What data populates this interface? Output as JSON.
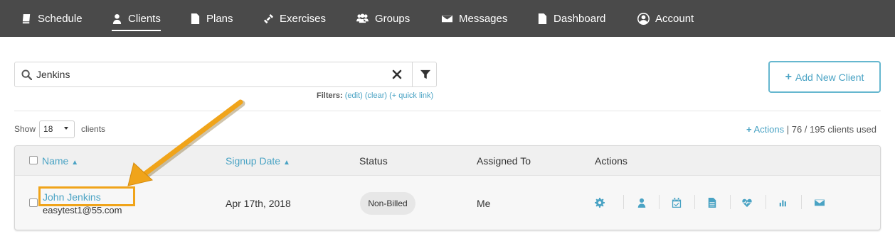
{
  "nav": {
    "items": [
      {
        "label": "Schedule",
        "icon": "book-icon"
      },
      {
        "label": "Clients",
        "icon": "user-icon",
        "active": true
      },
      {
        "label": "Plans",
        "icon": "document-icon"
      },
      {
        "label": "Exercises",
        "icon": "dumbbell-icon"
      },
      {
        "label": "Groups",
        "icon": "group-icon"
      },
      {
        "label": "Messages",
        "icon": "envelope-icon"
      },
      {
        "label": "Dashboard",
        "icon": "document-icon"
      },
      {
        "label": "Account",
        "icon": "account-icon"
      }
    ]
  },
  "search": {
    "value": "Jenkins"
  },
  "filters": {
    "label": "Filters:",
    "edit": "(edit)",
    "clear": "(clear)",
    "quick_link": "(+ quick link)"
  },
  "add_client_label": "Add New Client",
  "show": {
    "prefix": "Show",
    "value": "18",
    "suffix": "clients"
  },
  "usage": {
    "actions_label": "Actions",
    "count_text": "| 76 / 195 clients used"
  },
  "table": {
    "headers": {
      "name": "Name",
      "signup": "Signup Date",
      "status": "Status",
      "assigned": "Assigned To",
      "actions": "Actions"
    },
    "rows": [
      {
        "name": "John Jenkins",
        "email": "easytest1@55.com",
        "signup": "Apr 17th, 2018",
        "status": "Non-Billed",
        "assigned": "Me"
      }
    ]
  },
  "colors": {
    "nav_bg": "#4a4a4a",
    "accent": "#4aa3c4",
    "highlight": "#f0a41a"
  }
}
